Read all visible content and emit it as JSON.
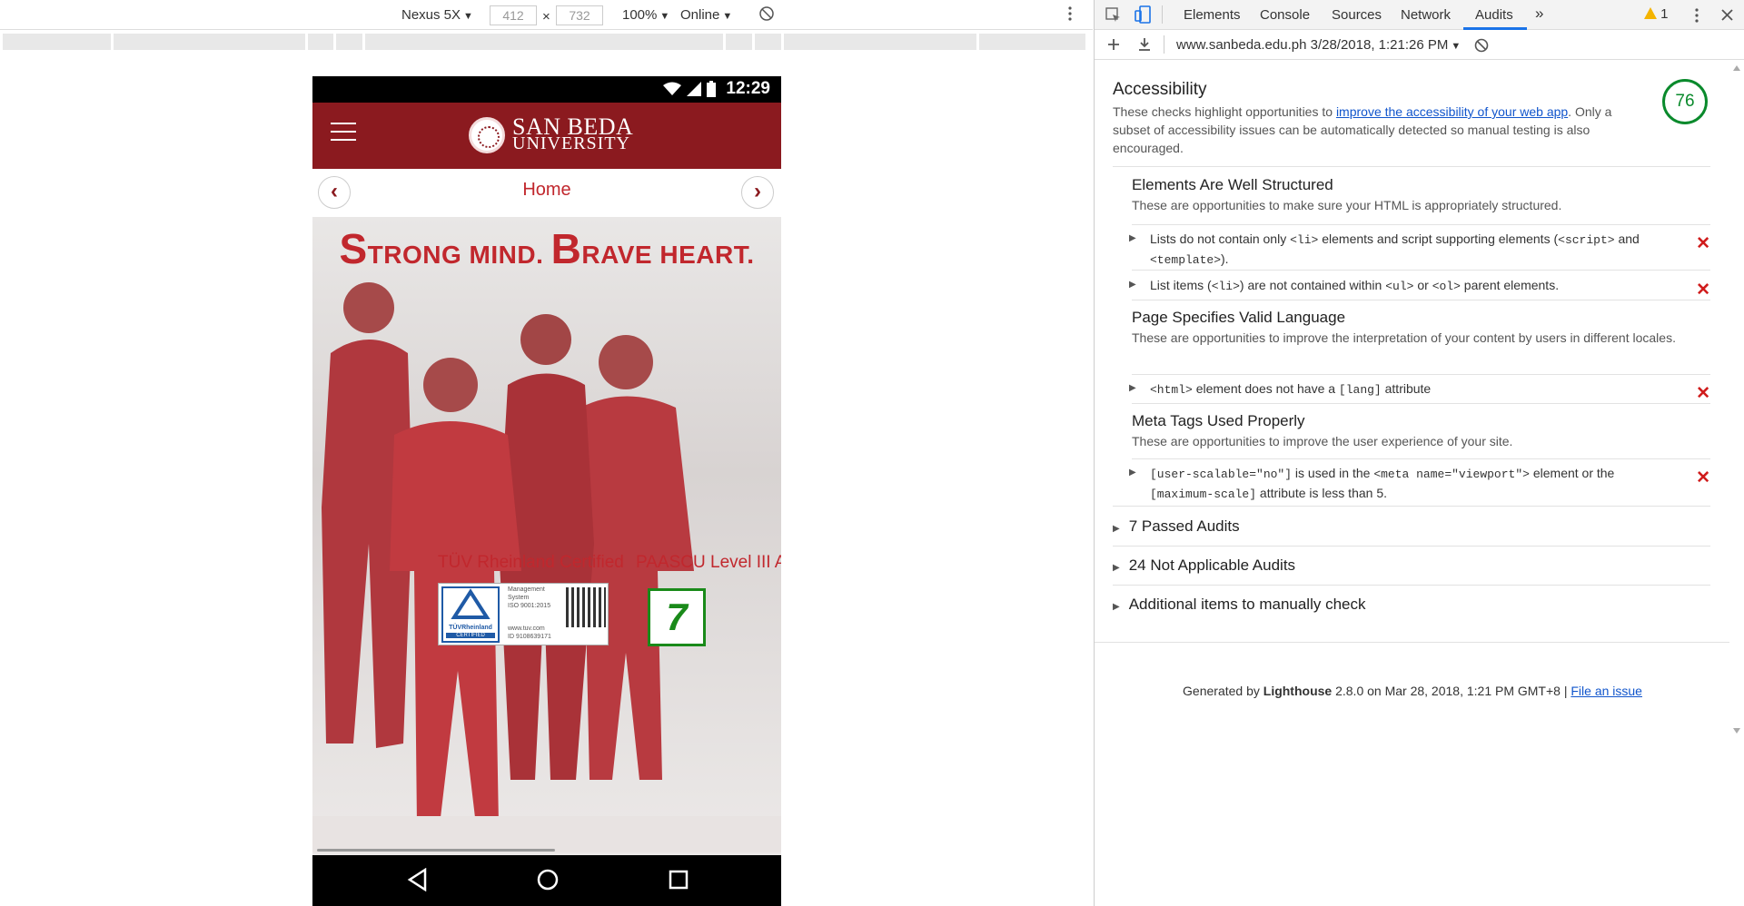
{
  "device_toolbar": {
    "device": "Nexus 5X",
    "width": "412",
    "height": "732",
    "times": "×",
    "zoom": "100%",
    "network": "Online"
  },
  "phone": {
    "time": "12:29",
    "site": {
      "logo_line1": "SAN BEDA",
      "logo_line2": "UNIVERSITY",
      "nav_title": "Home",
      "prev_arrow": "‹",
      "next_arrow": "›",
      "hero_s": "S",
      "hero_title_part1": "TRONG MIND. ",
      "hero_b": "B",
      "hero_title_part2": "RAVE HEART.",
      "cert1_label": "TÜV Rheinland Certified",
      "cert2_label": "PAASCU Level III Acc",
      "tuv_lines": [
        "Management",
        "System",
        "ISO 9001:2015",
        "www.tuv.com",
        "ID 9108639171"
      ],
      "tuv_brand": "TÜVRheinland",
      "tuv_certified": "CERTIFIED",
      "paascu_mark": "7"
    }
  },
  "devtools": {
    "tabs": [
      "Elements",
      "Console",
      "Sources",
      "Network",
      "Audits"
    ],
    "active_tab": "Audits",
    "more": "»",
    "warning_count": "1",
    "audit_url": "www.sanbeda.edu.ph 3/28/2018, 1:21:26 PM",
    "report": {
      "title": "Accessibility",
      "desc_before": "These checks highlight opportunities to ",
      "desc_link": "improve the accessibility of your web app",
      "desc_after": ". Only a subset of accessibility issues can be automatically detected so manual testing is also encouraged.",
      "score": "76",
      "score_color": "#0a8a2c",
      "groups": [
        {
          "title": "Elements Are Well Structured",
          "desc": "These are opportunities to make sure your HTML is appropriately structured."
        },
        {
          "title": "Page Specifies Valid Language",
          "desc": "These are opportunities to improve the interpretation of your content by users in different locales."
        },
        {
          "title": "Meta Tags Used Properly",
          "desc": "These are opportunities to improve the user experience of your site."
        }
      ],
      "audits": {
        "a1_p1": "Lists do not contain only ",
        "a1_c1": "<li>",
        "a1_p2": " elements and script supporting elements (",
        "a1_c2": "<script>",
        "a1_p3": " and ",
        "a1_c3": "<template>",
        "a1_p4": ").",
        "a2_p1": "List items (",
        "a2_c1": "<li>",
        "a2_p2": ") are not contained within ",
        "a2_c2": "<ul>",
        "a2_p3": " or ",
        "a2_c3": "<ol>",
        "a2_p4": " parent elements.",
        "a3_c1": "<html>",
        "a3_p1": " element does not have a ",
        "a3_c2": "[lang]",
        "a3_p2": " attribute",
        "a4_c1": "[user-scalable=\"no\"]",
        "a4_p1": " is used in the ",
        "a4_c2": "<meta name=\"viewport\">",
        "a4_p2": " element or the ",
        "a4_c3": "[maximum-scale]",
        "a4_p3": " attribute is less than 5.",
        "fail_mark": "✕"
      },
      "sections": [
        "7 Passed Audits",
        "24 Not Applicable Audits",
        "Additional items to manually check"
      ],
      "footer_before": "Generated by ",
      "footer_brand": "Lighthouse",
      "footer_after": " 2.8.0 on Mar 28, 2018, 1:21 PM GMT+8 | ",
      "footer_link": "File an issue"
    }
  }
}
